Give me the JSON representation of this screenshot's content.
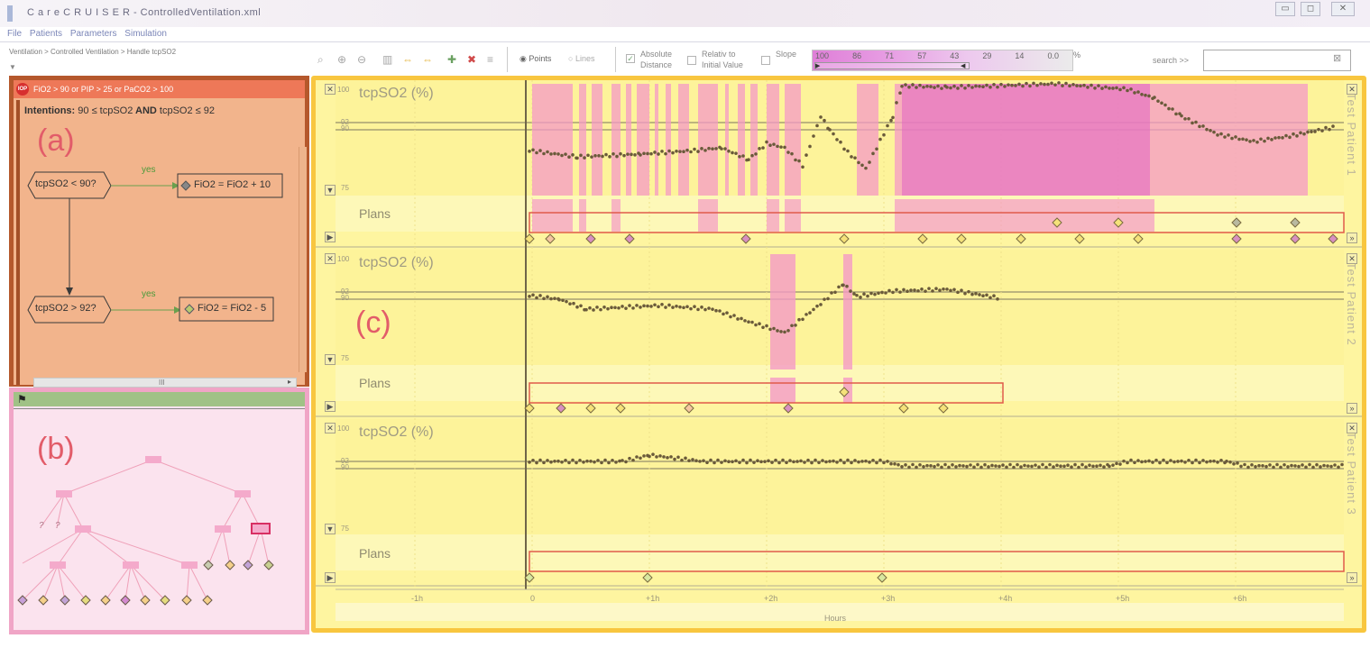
{
  "window": {
    "title": "C a r e C R U I S E R - ControlledVentilation.xml"
  },
  "menu": [
    "File",
    "Patients",
    "Parameters",
    "Simulation"
  ],
  "breadcrumb": "Ventilation > Controlled Ventilation > Handle tcpSO2",
  "toolbar": {
    "points": "Points",
    "lines": "Lines",
    "absolute": "Absolute Distance",
    "relative": "Relativ to Initial Value",
    "slope": "Slope",
    "scale_values": [
      "100",
      "86",
      "71",
      "57",
      "43",
      "29",
      "14",
      "0.0"
    ],
    "scale_unit": "%",
    "search_label": "search >>",
    "search_value": ""
  },
  "panel_a": {
    "badge": "IOP",
    "rule": "FiO2 > 90 or PIP > 25 or PaCO2 > 100",
    "intentions_label": "Intentions:",
    "intentions_pre": "90 ≤ tcpSO2",
    "intentions_and": "AND",
    "intentions_post": "tcpSO2 ≤ 92",
    "letter": "(a)",
    "cond1": "tcpSO2 < 90?",
    "act1": "FiO2 = FiO2 + 10",
    "cond2": "tcpSO2 > 92?",
    "act2": "FiO2 = FiO2 - 5",
    "yes1": "yes",
    "yes2": "yes",
    "scroll_grip": "III"
  },
  "panel_b": {
    "letter": "(b)",
    "q1": "?",
    "q2": "?"
  },
  "panel_c": {
    "letter": "(c)",
    "lanes": [
      {
        "title": "tcpSO2 (%)",
        "plans": "Plans",
        "patient": "Test Patient 1"
      },
      {
        "title": "tcpSO2 (%)",
        "plans": "Plans",
        "patient": "Test Patient 2"
      },
      {
        "title": "tcpSO2 (%)",
        "plans": "Plans",
        "patient": "Test Patient 3"
      }
    ],
    "y_labels": [
      "100",
      "92",
      "90",
      "75"
    ],
    "x_labels": [
      "-1h",
      "0",
      "+1h",
      "+2h",
      "+3h",
      "+4h",
      "+5h",
      "+6h"
    ],
    "x_axis_title": "Hours"
  }
}
